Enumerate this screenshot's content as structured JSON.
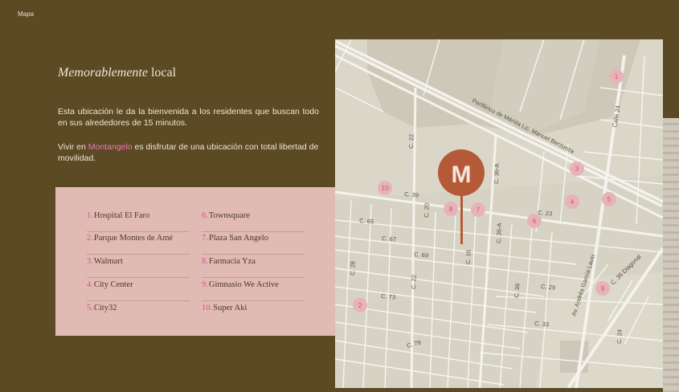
{
  "nav": {
    "label": "Mapa"
  },
  "section": {
    "title_italic": "Memorablemente",
    "title_rest": " local",
    "p1": "Esta ubicación le da la bienvenida a los residentes que buscan todo en sus alrededores de 15 minutos.",
    "p2_before": "Vivir en ",
    "p2_brand": "Montangelo",
    "p2_after": " es disfrutar de una ubicación con total libertad de movilidad."
  },
  "places": [
    {
      "num": "1.",
      "name": "Hospital El Faro"
    },
    {
      "num": "2.",
      "name": "Parque Montes de Amé"
    },
    {
      "num": "3.",
      "name": "Walmart"
    },
    {
      "num": "4.",
      "name": "City Center"
    },
    {
      "num": "5.",
      "name": "City32"
    },
    {
      "num": "6.",
      "name": "Townsquare"
    },
    {
      "num": "7.",
      "name": "Plaza San Angelo"
    },
    {
      "num": "8.",
      "name": "Farmacia Yza"
    },
    {
      "num": "9.",
      "name": "Gimnasio We Active"
    },
    {
      "num": "10.",
      "name": "Super Aki"
    }
  ],
  "map": {
    "logo_letter": "M",
    "markers": [
      "1",
      "2",
      "3",
      "4",
      "5",
      "6",
      "7",
      "8",
      "9",
      "10"
    ],
    "street_labels": {
      "periferico": "Periférico de Mérida Lic. Manuel Berzunza",
      "calle24": "Calle 24",
      "c22a": "C. 22",
      "c39": "C. 39",
      "c20": "C. 20",
      "c36a1": "C. 36-A",
      "c65": "C. 65",
      "c67": "C. 67",
      "c69": "C. 69",
      "c16": "C. 16",
      "c36a2": "C. 36-A",
      "c23": "C. 23",
      "c28": "C. 28",
      "c22b": "C. 22",
      "c73": "C. 73",
      "c38": "C. 38",
      "c29": "C. 29",
      "andres": "Av. Andrés García Lavin",
      "diagonal": "C. 36 Diagonal",
      "c33": "C. 33",
      "c79": "C. 79",
      "c24": "C. 24"
    }
  },
  "colors": {
    "background": "#5c4a24",
    "panel": "#e2bab4",
    "accent_pink": "#e879b9",
    "marker": "#e8b3b7",
    "logo": "#b55a38"
  }
}
